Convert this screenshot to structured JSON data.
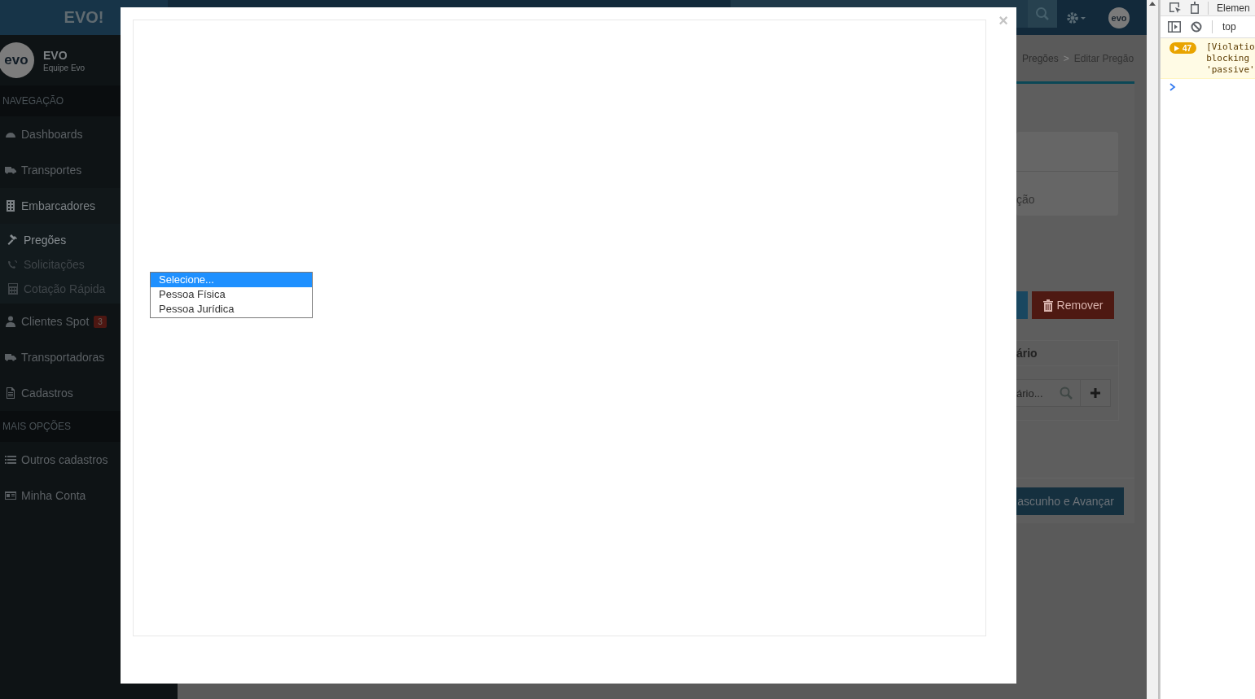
{
  "header": {
    "logo": "EVO!",
    "avatar_logo": "evo"
  },
  "user": {
    "avatar_logo": "evo",
    "name": "EVO",
    "team": "Equipe Evo"
  },
  "sidebar": {
    "sections": [
      {
        "title": "NAVEGAÇÃO",
        "items": [
          {
            "kind": "gauge",
            "label": "Dashboards",
            "selected": false
          },
          {
            "kind": "truck",
            "label": "Transportes",
            "selected": false
          },
          {
            "kind": "building",
            "label": "Embarcadores",
            "selected": false,
            "expanded": true,
            "children": [
              {
                "kind": "gavel",
                "label": "Pregões",
                "selected": true
              },
              {
                "kind": "phone",
                "label": "Solicitações",
                "selected": false
              },
              {
                "kind": "calculator",
                "label": "Cotação Rápida",
                "selected": false
              }
            ]
          },
          {
            "kind": "user",
            "label": "Clientes Spot",
            "selected": false,
            "badge": "3"
          },
          {
            "kind": "truck",
            "label": "Transportadoras",
            "selected": false
          },
          {
            "kind": "file",
            "label": "Cadastros",
            "selected": false
          }
        ]
      },
      {
        "title": "MAIS OPÇÕES",
        "items": [
          {
            "kind": "list",
            "label": "Outros cadastros",
            "selected": false
          },
          {
            "kind": "card",
            "label": "Minha Conta",
            "selected": false
          }
        ]
      }
    ]
  },
  "breadcrumb": {
    "items": [
      "Pregões",
      "Editar Pregão"
    ],
    "separator": ">"
  },
  "panel": {
    "step_label": "ção",
    "remove_button": "Remover",
    "card_title": "ário",
    "search": {
      "placeholder": "ário..."
    },
    "footer_button": "ascunho e Avançar"
  },
  "modal": {
    "close": "×",
    "options": [
      {
        "label": "Selecione...",
        "selected": true
      },
      {
        "label": "Pessoa Física",
        "selected": false
      },
      {
        "label": "Pessoa Jurídica",
        "selected": false
      }
    ]
  },
  "devtools": {
    "tab": "Elemen",
    "context": "top",
    "messages": [
      {
        "count": "47",
        "lines": [
          "[Violatio",
          "blocking",
          "'passive'"
        ]
      }
    ]
  }
}
